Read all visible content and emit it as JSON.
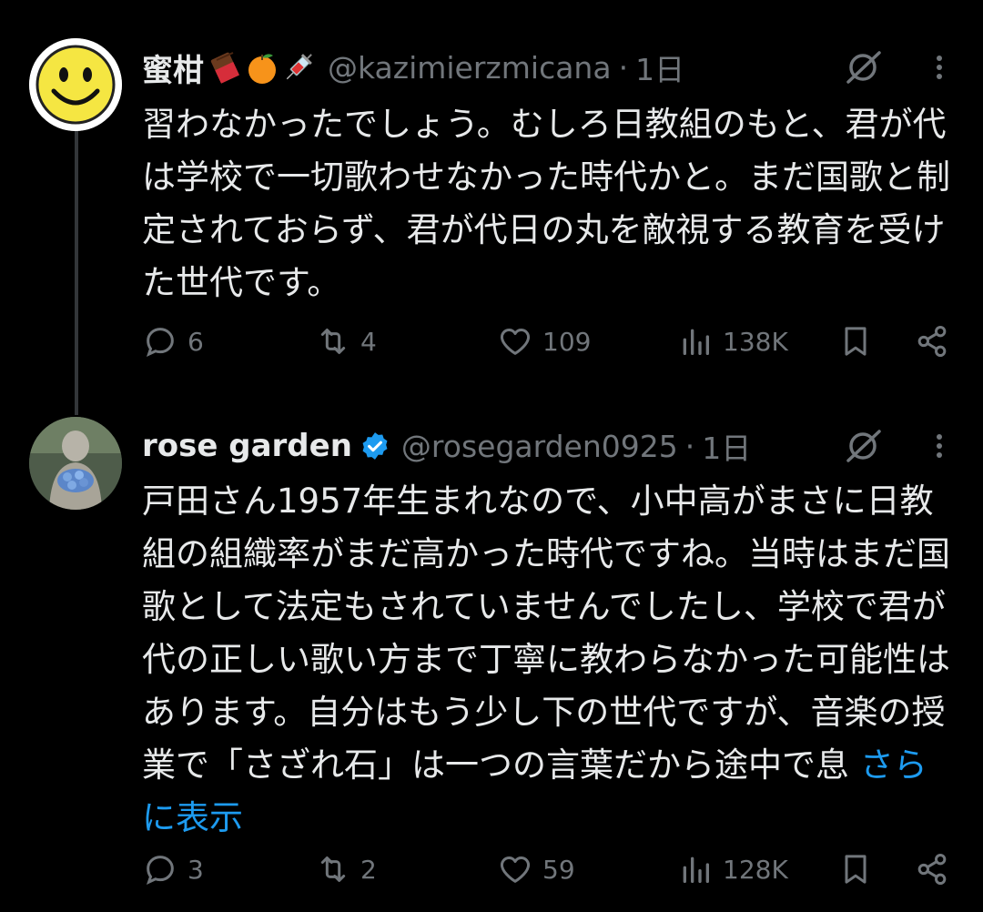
{
  "tweets": [
    {
      "name": "蜜柑",
      "emojis": [
        "chocolate-icon",
        "orange-icon",
        "syringe-icon"
      ],
      "handle": "@kazimierzmicana",
      "dot": "·",
      "time": "1日",
      "text": "習わなかったでしょう。むしろ日教組のもと、君が代は学校で一切歌わせなかった時代かと。まだ国歌と制定されておらず、君が代日の丸を敵視する教育を受けた世代です。",
      "show_more": "",
      "replies": "6",
      "retweets": "4",
      "likes": "109",
      "views": "138K"
    },
    {
      "name": "rose garden",
      "verified": true,
      "handle": "@rosegarden0925",
      "dot": "·",
      "time": "1日",
      "text": "戸田さん1957年生まれなので、小中高がまさに日教組の組織率がまだ高かった時代ですね。当時はまだ国歌として法定もされていませんでしたし、学校で君が代の正しい歌い方まで丁寧に教わらなかった可能性はあります。自分はもう少し下の世代ですが、音楽の授業で「さざれ石」は一つの言葉だから途中で息",
      "show_more": "さらに表示",
      "replies": "3",
      "retweets": "2",
      "likes": "59",
      "views": "128K"
    }
  ],
  "colors": {
    "background": "#000000",
    "text": "#e7e9ea",
    "secondary": "#71767b",
    "accent": "#1d9bf0"
  }
}
